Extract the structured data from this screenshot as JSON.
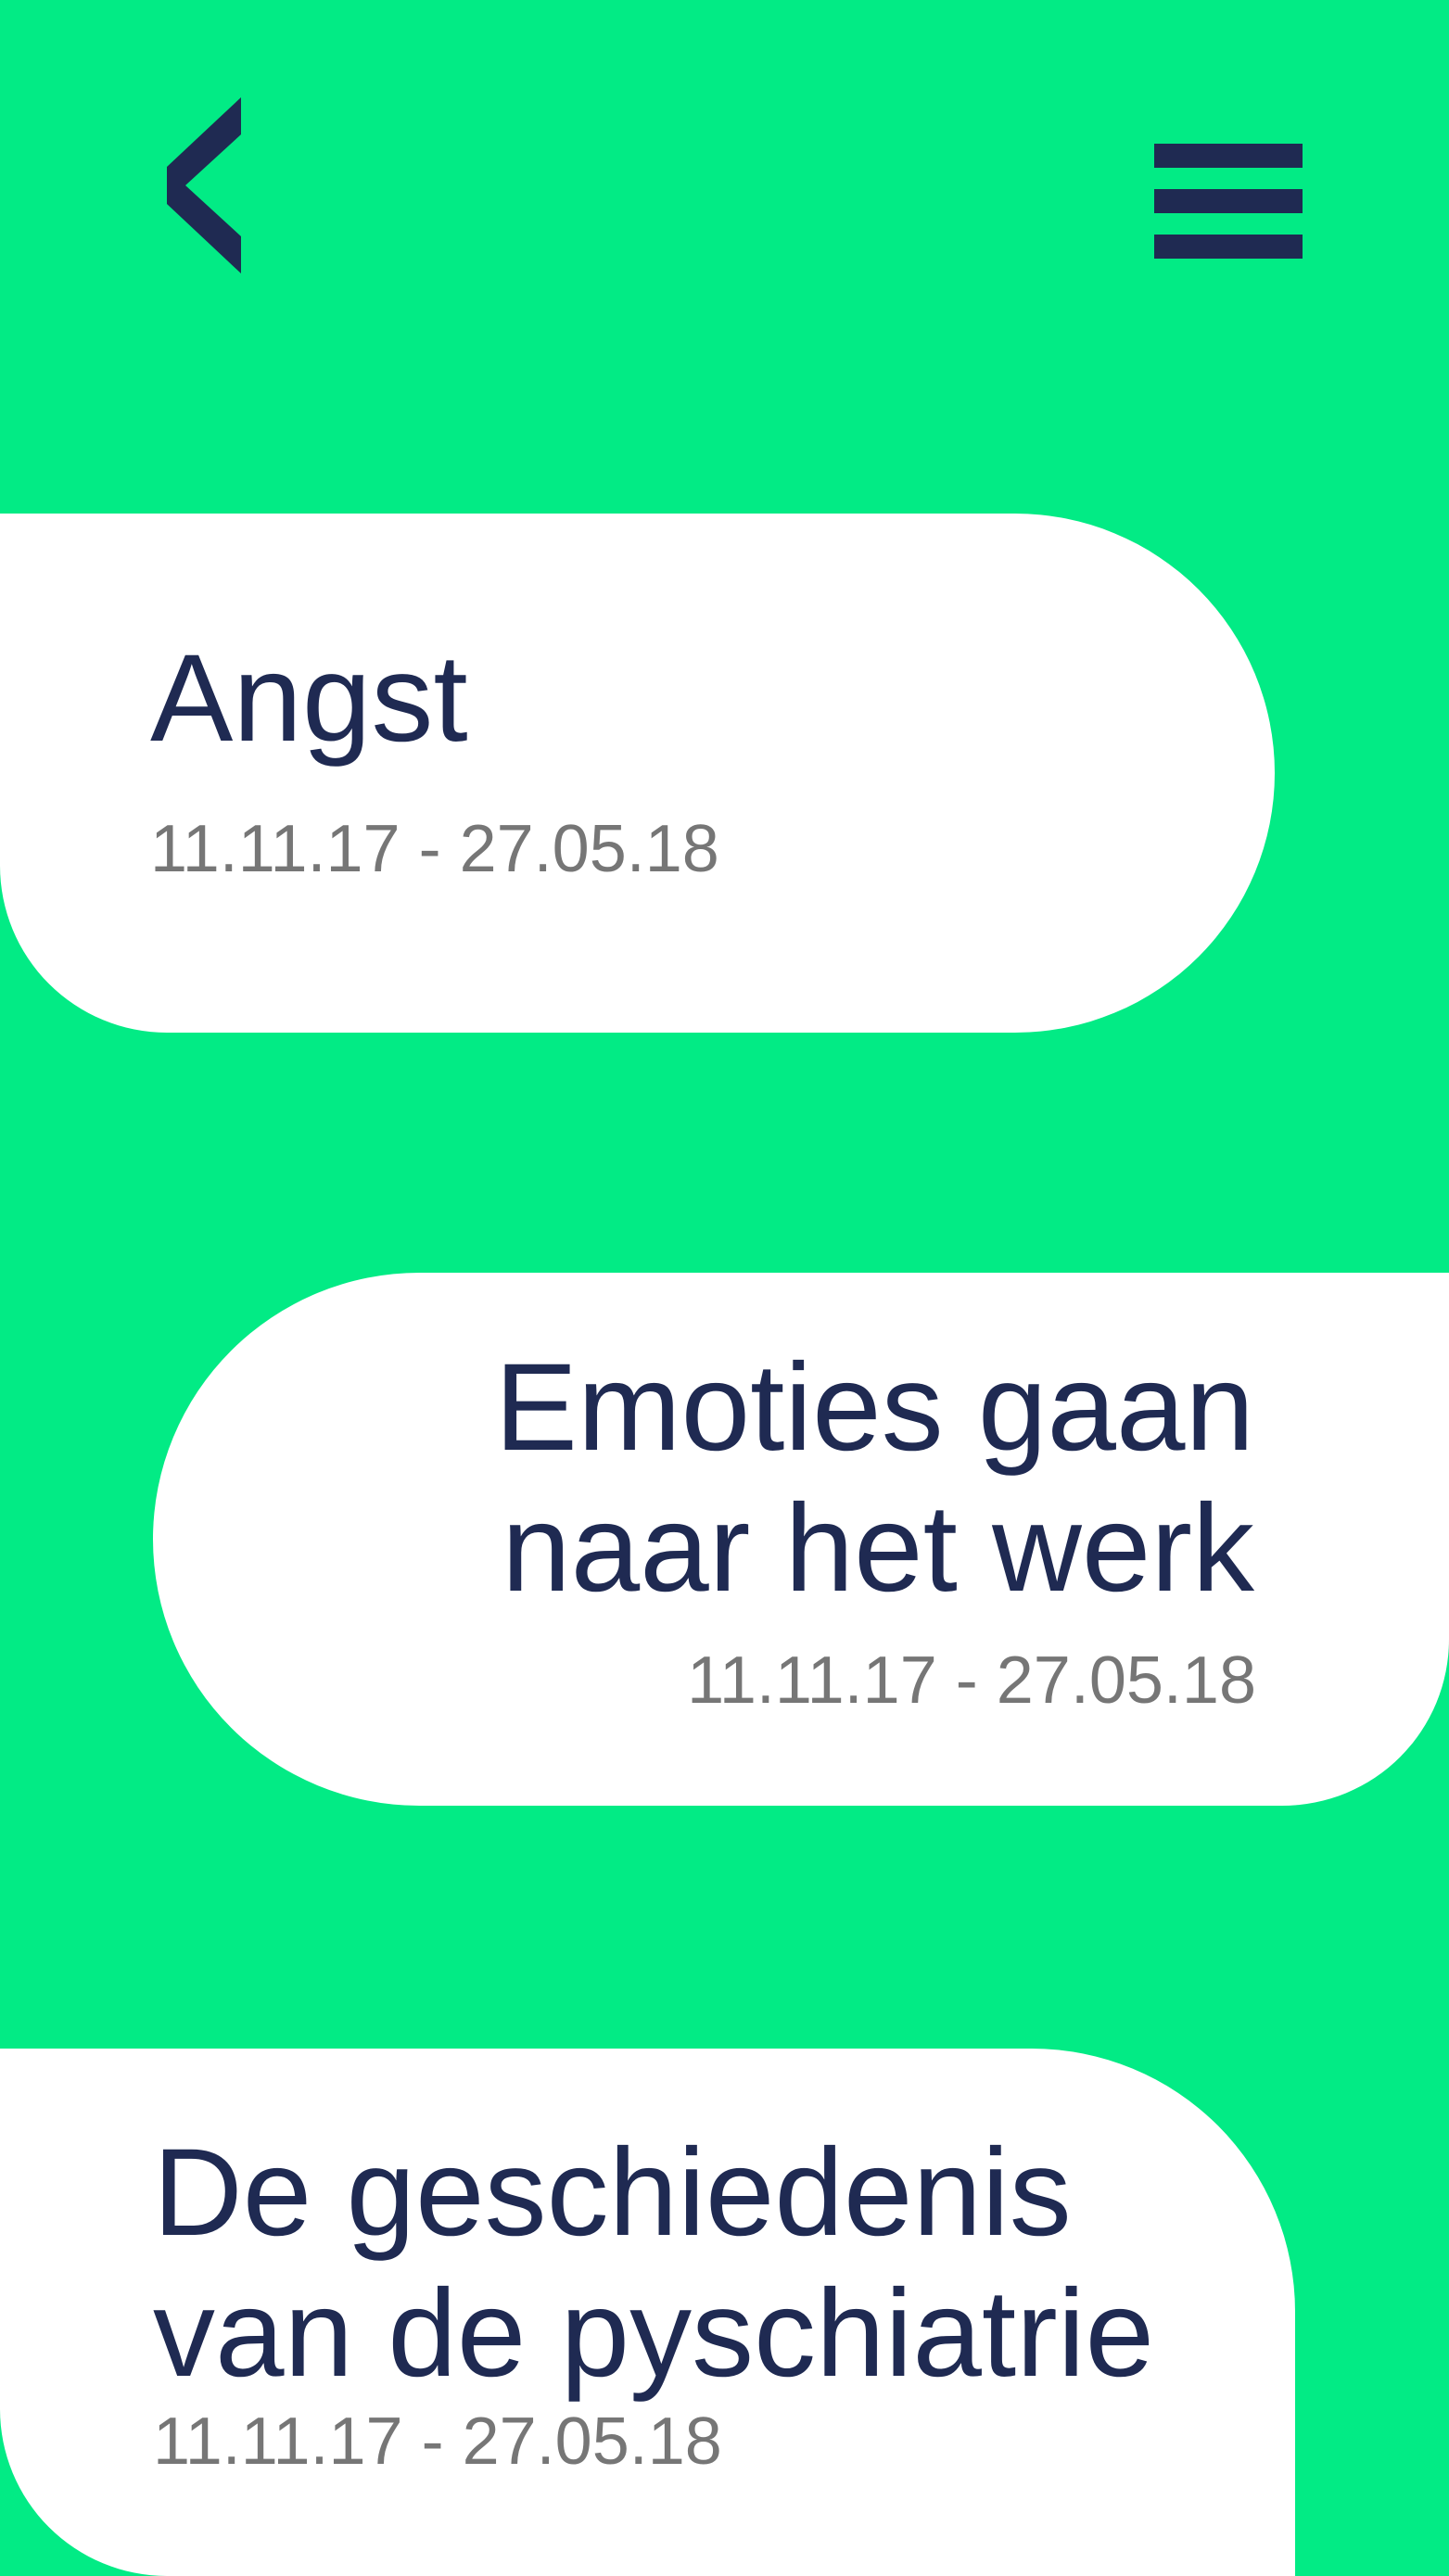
{
  "header": {
    "back_icon": "chevron-left-icon",
    "menu_icon": "hamburger-menu-icon"
  },
  "colors": {
    "background": "#02eb85",
    "card": "#ffffff",
    "title": "#1f2a52",
    "date": "#767676",
    "icon": "#1f2a52"
  },
  "topics": [
    {
      "title": "Angst",
      "dates": "11.11.17 - 27.05.18"
    },
    {
      "title": "Emoties gaan naar het werk",
      "dates": "11.11.17 - 27.05.18"
    },
    {
      "title": "De geschiedenis van de pyschiatrie",
      "dates": "11.11.17 - 27.05.18"
    }
  ]
}
